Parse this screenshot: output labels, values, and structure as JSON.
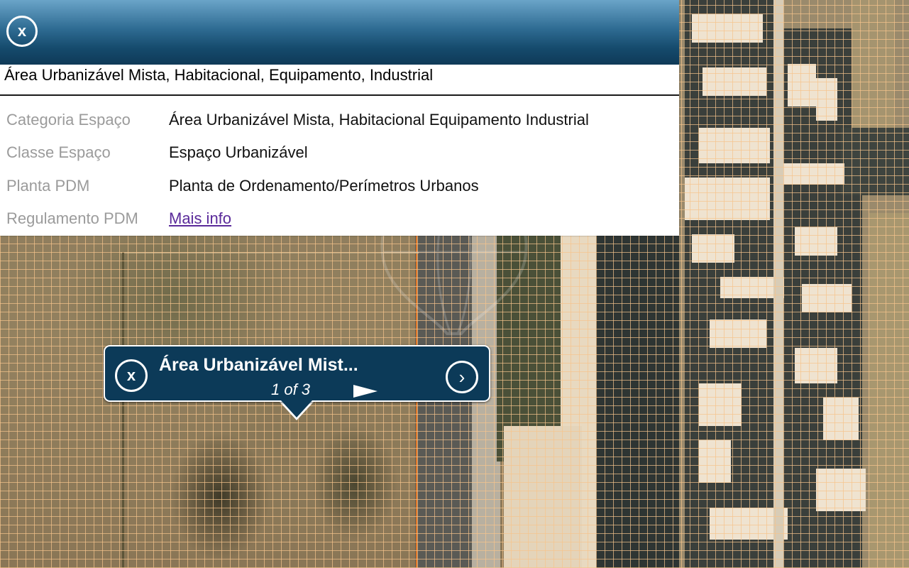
{
  "panel": {
    "title": "Área Urbanizável Mista, Habitacional, Equipamento, Industrial",
    "close_glyph": "x",
    "rows": [
      {
        "label": "Categoria Espaço",
        "value": "Área Urbanizável Mista, Habitacional Equipamento Industrial"
      },
      {
        "label": "Classe Espaço",
        "value": "Espaço Urbanizável"
      },
      {
        "label": "Planta PDM",
        "value": "Planta de Ordenamento/Perímetros Urbanos"
      },
      {
        "label": "Regulamento PDM",
        "value": "Mais info"
      }
    ]
  },
  "popup": {
    "title": "Área Urbanizável Mist...",
    "counter": "1 of 3",
    "close_glyph": "x",
    "next_glyph": "›"
  },
  "icons": {
    "panel_close": "close-icon",
    "popup_close": "close-icon",
    "popup_next": "chevron-right-icon",
    "popup_play": "play-icon"
  },
  "colors": {
    "header_dark": "#0f3a58",
    "header_light": "#6aa4c8",
    "popup_bg": "#0c3a58",
    "grid": "#f6c48c",
    "link": "#5a2a9a"
  }
}
